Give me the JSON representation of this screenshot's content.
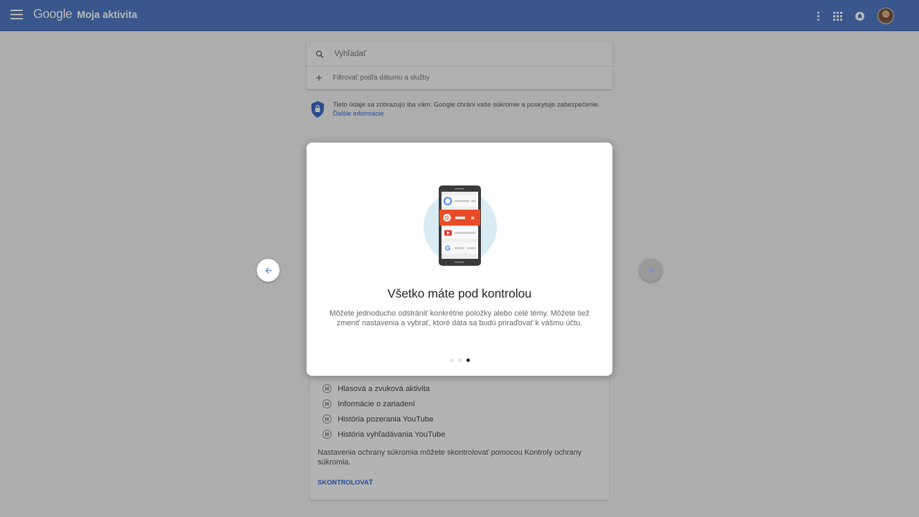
{
  "header": {
    "logo": "Google",
    "title": "Moja aktivita"
  },
  "search": {
    "placeholder": "Vyhľadať",
    "filter_label": "Filtrovať podľa dátumu a služby"
  },
  "privacy": {
    "text": "Tieto údaje sa zobrazujú iba vám. Google chráni vaše súkromie a poskytuje zabezpečenie.",
    "link": "Ďalšie informácie"
  },
  "settings": {
    "items": [
      {
        "label": "Hlasová a zvuková aktivita"
      },
      {
        "label": "Informácie o zariadení"
      },
      {
        "label": "História pozerania YouTube"
      },
      {
        "label": "História vyhľadávania YouTube"
      }
    ],
    "note": "Nastavenia ochrany súkromia môžete skontrolovať pomocou Kontroly ochrany súkromia.",
    "action": "SKONTROLOVAŤ"
  },
  "modal": {
    "title": "Všetko máte pod kontrolou",
    "body": "Môžete jednoducho odstrániť konkrétne položky alebo celé témy. Môžete tiež zmeniť nastavenia a vybrať, ktoré dáta sa budú priraďovať k vášmu účtu.",
    "page_total": 3,
    "page_current": 3
  },
  "colors": {
    "topbar": "#4f79c2",
    "accent": "#3367d6",
    "illustration_red": "#e84b27"
  },
  "icons": [
    "menu-icon",
    "more-vert-icon",
    "apps-icon",
    "notifications-icon",
    "search-icon",
    "add-icon",
    "shield-lock-icon",
    "pause-icon",
    "arrow-back-icon",
    "arrow-forward-icon"
  ]
}
